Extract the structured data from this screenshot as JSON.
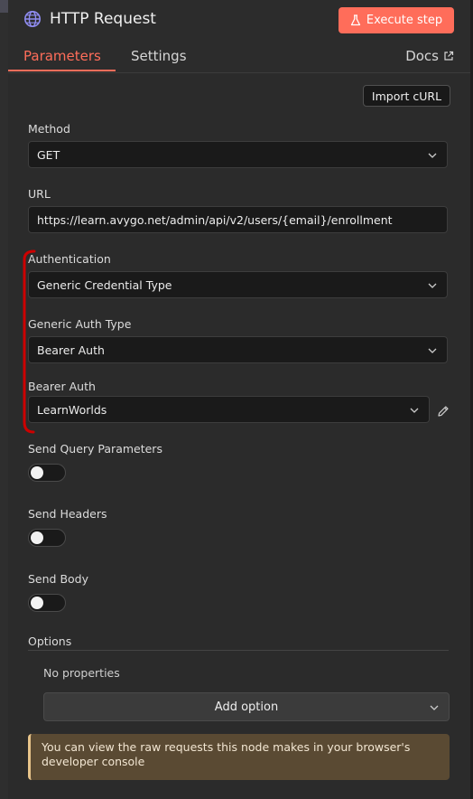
{
  "header": {
    "title": "HTTP Request",
    "execute_label": "Execute step"
  },
  "tabs": {
    "parameters": "Parameters",
    "settings": "Settings",
    "docs": "Docs"
  },
  "import_curl_label": "Import cURL",
  "fields": {
    "method": {
      "label": "Method",
      "value": "GET"
    },
    "url": {
      "label": "URL",
      "value": "https://learn.avygo.net/admin/api/v2/users/{email}/enrollment"
    },
    "authentication": {
      "label": "Authentication",
      "value": "Generic Credential Type"
    },
    "generic_auth_type": {
      "label": "Generic Auth Type",
      "value": "Bearer Auth"
    },
    "bearer_auth": {
      "label": "Bearer Auth",
      "value": "LearnWorlds"
    }
  },
  "toggles": {
    "send_query": {
      "label": "Send Query Parameters",
      "on": false
    },
    "send_headers": {
      "label": "Send Headers",
      "on": false
    },
    "send_body": {
      "label": "Send Body",
      "on": false
    }
  },
  "options": {
    "label": "Options",
    "empty_text": "No properties",
    "add_label": "Add option"
  },
  "note_text": "You can view the raw requests this node makes in your browser's developer console",
  "colors": {
    "accent": "#ff6d5a",
    "annotation": "#cc0000",
    "note_bg": "#5a4a33"
  }
}
